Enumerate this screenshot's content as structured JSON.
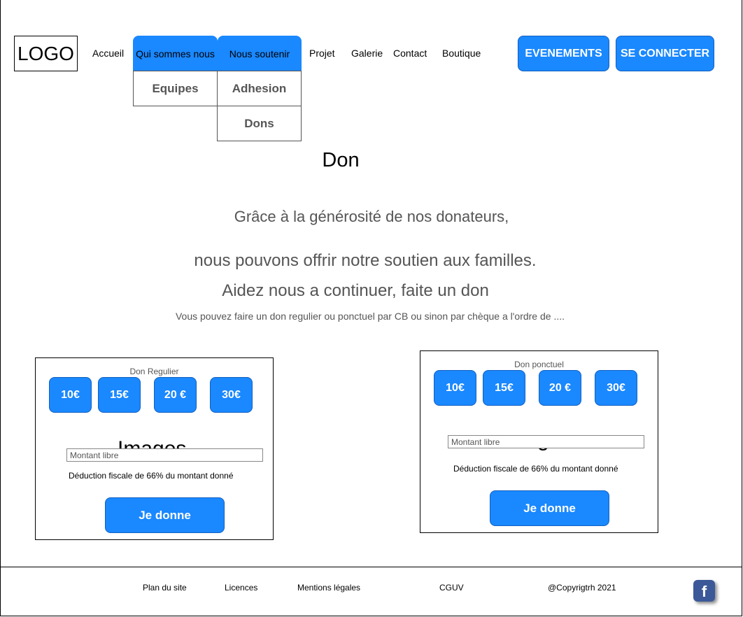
{
  "header": {
    "logo": "LOGO",
    "nav": {
      "accueil": "Accueil",
      "qui_sommes_nous": "Qui sommes nous",
      "nous_soutenir": "Nous soutenir",
      "projet": "Projet",
      "galerie": "Galerie",
      "contact": "Contact",
      "boutique": "Boutique"
    },
    "dropdown_qui": [
      "Equipes"
    ],
    "dropdown_soutenir": [
      "Adhesion",
      "Dons"
    ],
    "evenements_label": "EVENEMENTS",
    "connect_label": "SE CONNECTER",
    "accent_color": "#1a88ff"
  },
  "page": {
    "title": "Don"
  },
  "intro": {
    "line1": "Grâce à la générosité de nos donateurs,",
    "line2": "nous pouvons offrir notre soutien aux familles.",
    "line3": "Aidez nous a continuer, faite un don",
    "line4": "Vous pouvez faire un don regulier ou ponctuel par CB ou sinon par chèque a l'ordre de ...."
  },
  "regular": {
    "title": "Don Regulier",
    "amounts": [
      "10€",
      "15€",
      "20 €",
      "30€"
    ],
    "ghost": "Images",
    "placeholder": "Montant libre",
    "deduction": "Déduction fiscale de 66% du montant donné",
    "button": "Je donne"
  },
  "oneoff": {
    "title": "Don ponctuel",
    "amounts": [
      "10€",
      "15€",
      "20 €",
      "30€"
    ],
    "ghost": "Images",
    "placeholder": "Montant libre",
    "deduction": "Déduction fiscale de 66% du montant donné",
    "button": "Je donne"
  },
  "footer": {
    "plan": "Plan du site",
    "licences": "Licences",
    "mentions": "Mentions légales",
    "cguv": "CGUV",
    "copyright": "@Copyrigtrh 2021",
    "facebook_icon": "f"
  }
}
